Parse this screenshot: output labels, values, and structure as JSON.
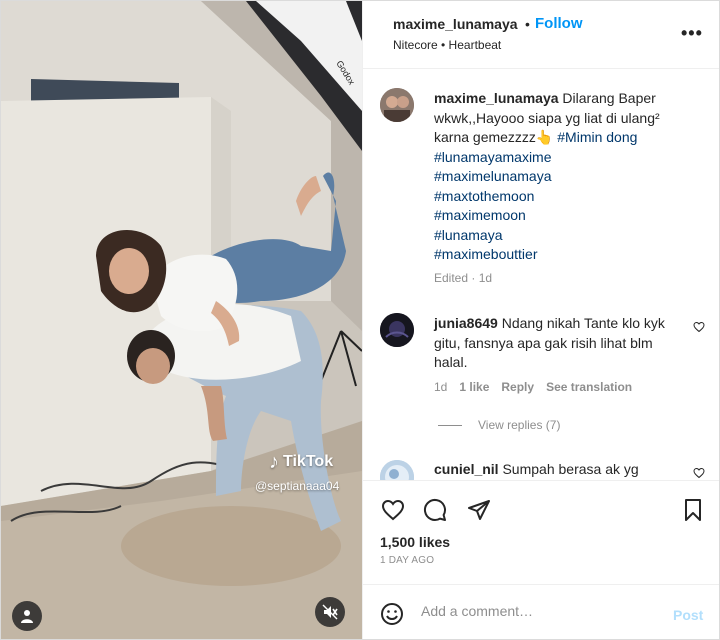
{
  "post": {
    "username": "maxime_lunamaya",
    "follow_label": "Follow",
    "separator": "•",
    "audio": "Nitecore • Heartbeat",
    "more_label": "•••"
  },
  "media": {
    "watermark_brand": "TikTok",
    "watermark_handle": "@septianaaa04",
    "light_box_brand": "Godox"
  },
  "caption": {
    "username": "maxime_lunamaya",
    "text": "Dilarang Baper wkwk,,Hayooo siapa yg liat di ulang² karna gemezzzz👆",
    "inline_tag": "#Mimin dong",
    "tags": [
      "#lunamayamaxime",
      "#maximelunamaya",
      "#maxtothemoon",
      "#maximemoon",
      "#lunamaya",
      "#maximebouttier"
    ],
    "meta": "Edited · 1d"
  },
  "comments": [
    {
      "username": "junia8649",
      "text": "Ndang nikah Tante klo kyk gitu, fansnya apa gak risih lihat blm halal.",
      "time": "1d",
      "likes": "1 like",
      "reply_label": "Reply",
      "translate_label": "See translation",
      "view_replies": "View replies (7)"
    },
    {
      "username": "cuniel_nil",
      "text": "Sumpah berasa ak yg"
    }
  ],
  "stats": {
    "likes": "1,500 likes",
    "date": "1 DAY AGO"
  },
  "composer": {
    "placeholder": "Add a comment…",
    "post_label": "Post"
  },
  "icons": {
    "like": "heart-icon",
    "comment": "comment-icon",
    "share": "share-icon",
    "save": "bookmark-icon",
    "emoji": "emoji-icon",
    "user": "user-icon",
    "mute": "speaker-muted-icon"
  },
  "colors": {
    "link_blue": "#0095f6",
    "hashtag": "#00376b",
    "muted_text": "#8e8e8e",
    "post_disabled": "#b2dffc"
  }
}
